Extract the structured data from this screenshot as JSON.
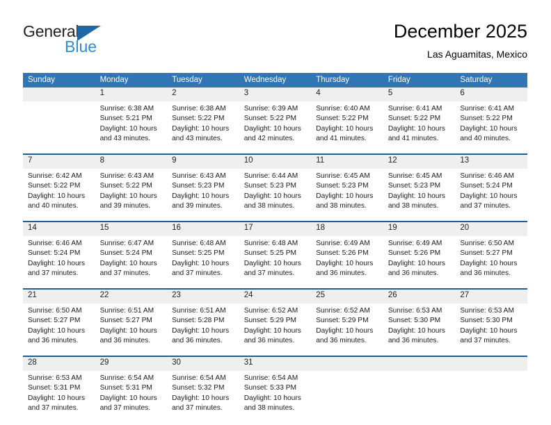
{
  "brand": {
    "name_part1": "General",
    "name_part2": "Blue",
    "logo_icon": "triangle-icon"
  },
  "header": {
    "title": "December 2025",
    "subtitle": "Las Aguamitas, Mexico"
  },
  "calendar": {
    "weekday_headers": [
      "Sunday",
      "Monday",
      "Tuesday",
      "Wednesday",
      "Thursday",
      "Friday",
      "Saturday"
    ],
    "colors": {
      "header_blue": "#3175b4",
      "separator_blue": "#1c5d9c",
      "daynum_band": "#efefef",
      "brand_blue": "#2e8bd6",
      "logo_blue": "#1c68a8"
    },
    "weeks": [
      {
        "days": [
          {
            "num": "",
            "sunrise": "",
            "sunset": "",
            "daylight_line1": "",
            "daylight_line2": ""
          },
          {
            "num": "1",
            "sunrise": "Sunrise: 6:38 AM",
            "sunset": "Sunset: 5:21 PM",
            "daylight_line1": "Daylight: 10 hours",
            "daylight_line2": "and 43 minutes."
          },
          {
            "num": "2",
            "sunrise": "Sunrise: 6:38 AM",
            "sunset": "Sunset: 5:22 PM",
            "daylight_line1": "Daylight: 10 hours",
            "daylight_line2": "and 43 minutes."
          },
          {
            "num": "3",
            "sunrise": "Sunrise: 6:39 AM",
            "sunset": "Sunset: 5:22 PM",
            "daylight_line1": "Daylight: 10 hours",
            "daylight_line2": "and 42 minutes."
          },
          {
            "num": "4",
            "sunrise": "Sunrise: 6:40 AM",
            "sunset": "Sunset: 5:22 PM",
            "daylight_line1": "Daylight: 10 hours",
            "daylight_line2": "and 41 minutes."
          },
          {
            "num": "5",
            "sunrise": "Sunrise: 6:41 AM",
            "sunset": "Sunset: 5:22 PM",
            "daylight_line1": "Daylight: 10 hours",
            "daylight_line2": "and 41 minutes."
          },
          {
            "num": "6",
            "sunrise": "Sunrise: 6:41 AM",
            "sunset": "Sunset: 5:22 PM",
            "daylight_line1": "Daylight: 10 hours",
            "daylight_line2": "and 40 minutes."
          }
        ]
      },
      {
        "days": [
          {
            "num": "7",
            "sunrise": "Sunrise: 6:42 AM",
            "sunset": "Sunset: 5:22 PM",
            "daylight_line1": "Daylight: 10 hours",
            "daylight_line2": "and 40 minutes."
          },
          {
            "num": "8",
            "sunrise": "Sunrise: 6:43 AM",
            "sunset": "Sunset: 5:22 PM",
            "daylight_line1": "Daylight: 10 hours",
            "daylight_line2": "and 39 minutes."
          },
          {
            "num": "9",
            "sunrise": "Sunrise: 6:43 AM",
            "sunset": "Sunset: 5:23 PM",
            "daylight_line1": "Daylight: 10 hours",
            "daylight_line2": "and 39 minutes."
          },
          {
            "num": "10",
            "sunrise": "Sunrise: 6:44 AM",
            "sunset": "Sunset: 5:23 PM",
            "daylight_line1": "Daylight: 10 hours",
            "daylight_line2": "and 38 minutes."
          },
          {
            "num": "11",
            "sunrise": "Sunrise: 6:45 AM",
            "sunset": "Sunset: 5:23 PM",
            "daylight_line1": "Daylight: 10 hours",
            "daylight_line2": "and 38 minutes."
          },
          {
            "num": "12",
            "sunrise": "Sunrise: 6:45 AM",
            "sunset": "Sunset: 5:23 PM",
            "daylight_line1": "Daylight: 10 hours",
            "daylight_line2": "and 38 minutes."
          },
          {
            "num": "13",
            "sunrise": "Sunrise: 6:46 AM",
            "sunset": "Sunset: 5:24 PM",
            "daylight_line1": "Daylight: 10 hours",
            "daylight_line2": "and 37 minutes."
          }
        ]
      },
      {
        "days": [
          {
            "num": "14",
            "sunrise": "Sunrise: 6:46 AM",
            "sunset": "Sunset: 5:24 PM",
            "daylight_line1": "Daylight: 10 hours",
            "daylight_line2": "and 37 minutes."
          },
          {
            "num": "15",
            "sunrise": "Sunrise: 6:47 AM",
            "sunset": "Sunset: 5:24 PM",
            "daylight_line1": "Daylight: 10 hours",
            "daylight_line2": "and 37 minutes."
          },
          {
            "num": "16",
            "sunrise": "Sunrise: 6:48 AM",
            "sunset": "Sunset: 5:25 PM",
            "daylight_line1": "Daylight: 10 hours",
            "daylight_line2": "and 37 minutes."
          },
          {
            "num": "17",
            "sunrise": "Sunrise: 6:48 AM",
            "sunset": "Sunset: 5:25 PM",
            "daylight_line1": "Daylight: 10 hours",
            "daylight_line2": "and 37 minutes."
          },
          {
            "num": "18",
            "sunrise": "Sunrise: 6:49 AM",
            "sunset": "Sunset: 5:26 PM",
            "daylight_line1": "Daylight: 10 hours",
            "daylight_line2": "and 36 minutes."
          },
          {
            "num": "19",
            "sunrise": "Sunrise: 6:49 AM",
            "sunset": "Sunset: 5:26 PM",
            "daylight_line1": "Daylight: 10 hours",
            "daylight_line2": "and 36 minutes."
          },
          {
            "num": "20",
            "sunrise": "Sunrise: 6:50 AM",
            "sunset": "Sunset: 5:27 PM",
            "daylight_line1": "Daylight: 10 hours",
            "daylight_line2": "and 36 minutes."
          }
        ]
      },
      {
        "days": [
          {
            "num": "21",
            "sunrise": "Sunrise: 6:50 AM",
            "sunset": "Sunset: 5:27 PM",
            "daylight_line1": "Daylight: 10 hours",
            "daylight_line2": "and 36 minutes."
          },
          {
            "num": "22",
            "sunrise": "Sunrise: 6:51 AM",
            "sunset": "Sunset: 5:27 PM",
            "daylight_line1": "Daylight: 10 hours",
            "daylight_line2": "and 36 minutes."
          },
          {
            "num": "23",
            "sunrise": "Sunrise: 6:51 AM",
            "sunset": "Sunset: 5:28 PM",
            "daylight_line1": "Daylight: 10 hours",
            "daylight_line2": "and 36 minutes."
          },
          {
            "num": "24",
            "sunrise": "Sunrise: 6:52 AM",
            "sunset": "Sunset: 5:29 PM",
            "daylight_line1": "Daylight: 10 hours",
            "daylight_line2": "and 36 minutes."
          },
          {
            "num": "25",
            "sunrise": "Sunrise: 6:52 AM",
            "sunset": "Sunset: 5:29 PM",
            "daylight_line1": "Daylight: 10 hours",
            "daylight_line2": "and 36 minutes."
          },
          {
            "num": "26",
            "sunrise": "Sunrise: 6:53 AM",
            "sunset": "Sunset: 5:30 PM",
            "daylight_line1": "Daylight: 10 hours",
            "daylight_line2": "and 36 minutes."
          },
          {
            "num": "27",
            "sunrise": "Sunrise: 6:53 AM",
            "sunset": "Sunset: 5:30 PM",
            "daylight_line1": "Daylight: 10 hours",
            "daylight_line2": "and 37 minutes."
          }
        ]
      },
      {
        "days": [
          {
            "num": "28",
            "sunrise": "Sunrise: 6:53 AM",
            "sunset": "Sunset: 5:31 PM",
            "daylight_line1": "Daylight: 10 hours",
            "daylight_line2": "and 37 minutes."
          },
          {
            "num": "29",
            "sunrise": "Sunrise: 6:54 AM",
            "sunset": "Sunset: 5:31 PM",
            "daylight_line1": "Daylight: 10 hours",
            "daylight_line2": "and 37 minutes."
          },
          {
            "num": "30",
            "sunrise": "Sunrise: 6:54 AM",
            "sunset": "Sunset: 5:32 PM",
            "daylight_line1": "Daylight: 10 hours",
            "daylight_line2": "and 37 minutes."
          },
          {
            "num": "31",
            "sunrise": "Sunrise: 6:54 AM",
            "sunset": "Sunset: 5:33 PM",
            "daylight_line1": "Daylight: 10 hours",
            "daylight_line2": "and 38 minutes."
          },
          {
            "num": "",
            "sunrise": "",
            "sunset": "",
            "daylight_line1": "",
            "daylight_line2": ""
          },
          {
            "num": "",
            "sunrise": "",
            "sunset": "",
            "daylight_line1": "",
            "daylight_line2": ""
          },
          {
            "num": "",
            "sunrise": "",
            "sunset": "",
            "daylight_line1": "",
            "daylight_line2": ""
          }
        ]
      }
    ]
  }
}
